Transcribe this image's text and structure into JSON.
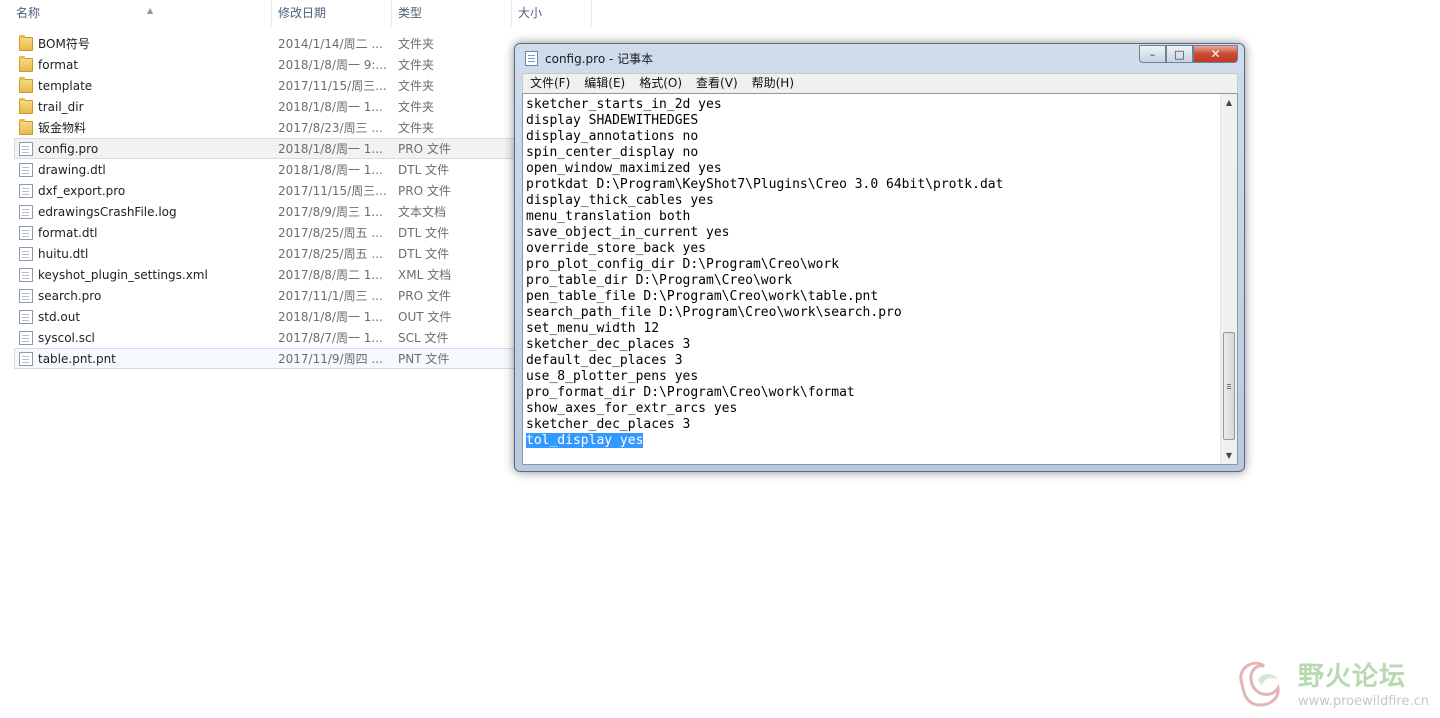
{
  "explorer": {
    "columns": {
      "name": "名称",
      "date": "修改日期",
      "type": "类型",
      "size": "大小"
    },
    "rows": [
      {
        "name": "BOM符号",
        "date": "2014/1/14/周二 ...",
        "type": "文件夹",
        "icon": "folder-icon"
      },
      {
        "name": "format",
        "date": "2018/1/8/周一 9:...",
        "type": "文件夹",
        "icon": "folder-icon"
      },
      {
        "name": "template",
        "date": "2017/11/15/周三...",
        "type": "文件夹",
        "icon": "folder-icon"
      },
      {
        "name": "trail_dir",
        "date": "2018/1/8/周一 1...",
        "type": "文件夹",
        "icon": "folder-icon"
      },
      {
        "name": "钣金物料",
        "date": "2017/8/23/周三 ...",
        "type": "文件夹",
        "icon": "folder-icon"
      },
      {
        "name": "config.pro",
        "date": "2018/1/8/周一 1...",
        "type": "PRO 文件",
        "icon": "file-icon"
      },
      {
        "name": "drawing.dtl",
        "date": "2018/1/8/周一 1...",
        "type": "DTL 文件",
        "icon": "file-icon"
      },
      {
        "name": "dxf_export.pro",
        "date": "2017/11/15/周三...",
        "type": "PRO 文件",
        "icon": "file-icon"
      },
      {
        "name": "edrawingsCrashFile.log",
        "date": "2017/8/9/周三 1...",
        "type": "文本文档",
        "icon": "file-icon"
      },
      {
        "name": "format.dtl",
        "date": "2017/8/25/周五 ...",
        "type": "DTL 文件",
        "icon": "file-icon"
      },
      {
        "name": "huitu.dtl",
        "date": "2017/8/25/周五 ...",
        "type": "DTL 文件",
        "icon": "file-icon"
      },
      {
        "name": "keyshot_plugin_settings.xml",
        "date": "2017/8/8/周二 1...",
        "type": "XML 文档",
        "icon": "xml-file-icon"
      },
      {
        "name": "search.pro",
        "date": "2017/11/1/周三 ...",
        "type": "PRO 文件",
        "icon": "file-icon"
      },
      {
        "name": "std.out",
        "date": "2018/1/8/周一 1...",
        "type": "OUT 文件",
        "icon": "file-icon"
      },
      {
        "name": "syscol.scl",
        "date": "2017/8/7/周一 1...",
        "type": "SCL 文件",
        "icon": "file-icon"
      },
      {
        "name": "table.pnt.pnt",
        "date": "2017/11/9/周四 ...",
        "type": "PNT 文件",
        "icon": "file-icon"
      }
    ]
  },
  "notepad": {
    "title": "config.pro - 记事本",
    "menu": [
      "文件(F)",
      "编辑(E)",
      "格式(O)",
      "查看(V)",
      "帮助(H)"
    ],
    "lines": [
      "sketcher_starts_in_2d yes",
      "display SHADEWITHEDGES",
      "display_annotations no",
      "spin_center_display no",
      "open_window_maximized yes",
      "protkdat D:\\Program\\KeyShot7\\Plugins\\Creo 3.0 64bit\\protk.dat",
      "display_thick_cables yes",
      "menu_translation both",
      "save_object_in_current yes",
      "override_store_back yes",
      "pro_plot_config_dir D:\\Program\\Creo\\work",
      "pro_table_dir D:\\Program\\Creo\\work",
      "pen_table_file D:\\Program\\Creo\\work\\table.pnt",
      "search_path_file D:\\Program\\Creo\\work\\search.pro",
      "set_menu_width 12",
      "sketcher_dec_places 3",
      "default_dec_places 3",
      "use_8_plotter_pens yes",
      "pro_format_dir D:\\Program\\Creo\\work\\format",
      "show_axes_for_extr_arcs yes",
      "sketcher_dec_places 3"
    ],
    "selected_line": "tol_display yes",
    "controls": {
      "minimize": "–",
      "maximize": "□",
      "close": "✕"
    }
  },
  "watermark": {
    "title": "野火论坛",
    "url": "www.proewildfire.cn"
  },
  "colors": {
    "selection": "#3399ff",
    "close_button": "#c74b32"
  }
}
